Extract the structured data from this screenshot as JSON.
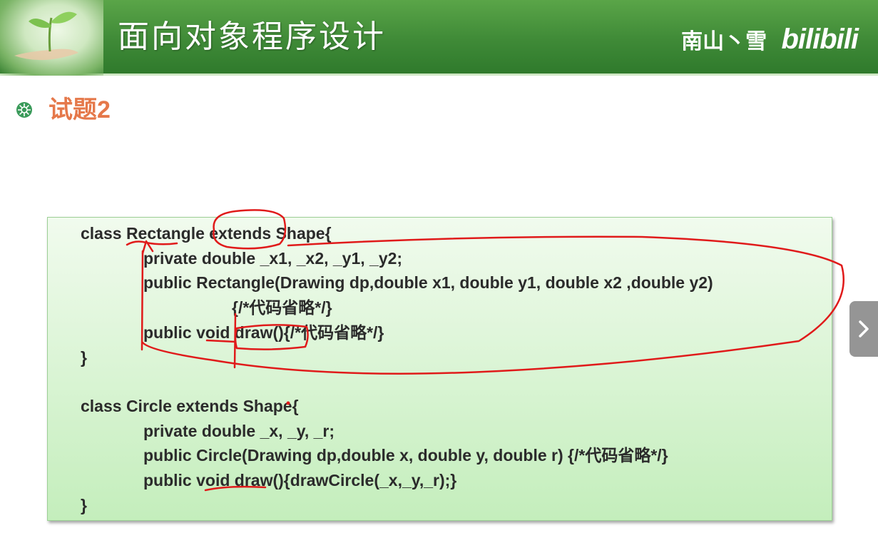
{
  "header": {
    "title": "面向对象程序设计",
    "watermark": {
      "uploader": "南山丶雪",
      "brand": "bilibili"
    }
  },
  "section": {
    "heading": "试题2"
  },
  "code": {
    "lines": [
      "class Rectangle extends Shape{",
      "private double _x1, _x2, _y1, _y2;",
      "public Rectangle(Drawing dp,double x1, double y1, double x2 ,double y2)",
      "{/*代码省略*/}",
      "public void draw(){/*代码省略*/}",
      "}",
      "class Circle extends Shape{",
      "private double _x, _y, _r;",
      "public Circle(Drawing dp,double x, double y, double r) {/*代码省略*/}",
      "public void draw(){drawCircle(_x,_y,_r);}",
      "}"
    ]
  },
  "colors": {
    "header_green": "#3f8a37",
    "heading_orange": "#e5784a",
    "annotation_red": "#e01a1a",
    "code_box_green": "#c4eebc"
  },
  "icons": {
    "bullet": "gear-flower-icon",
    "next": "chevron-right-icon"
  }
}
